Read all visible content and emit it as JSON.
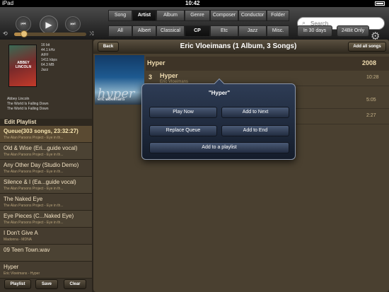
{
  "status": {
    "carrier": "iPad",
    "time": "10:42"
  },
  "transport": {
    "prev": "⏮",
    "play": "▶",
    "next": "⏭",
    "loop": "⟲",
    "shuffle": "⤨",
    "progress": 0.14
  },
  "filters_top": [
    "Song",
    "Artist",
    "Album",
    "Genre",
    "Composer",
    "Conductor",
    "Folder"
  ],
  "filters_top_selected": "Artist",
  "filters_bottom": [
    "All",
    "Albert",
    "Classical",
    "CP",
    "Etc",
    "Jazz",
    "Misc."
  ],
  "filters_bottom_selected": "CP",
  "search": {
    "placeholder": "Search"
  },
  "quick": {
    "recent": "In 30 days",
    "bitdepth": "24Bit Only"
  },
  "now_playing": {
    "file_info": [
      "16 bit",
      "44.1 kHz",
      "AIFF",
      "1411 kbps",
      "64.3 MB",
      "Jazz"
    ],
    "cover_text": "ABBEY LINCOLN",
    "artist": "Abbey Lincoln",
    "track": "The World Is Falling Down",
    "album": "The World Is Falling Down"
  },
  "playlist": {
    "header": "Edit Playlist",
    "items": [
      {
        "title": "Queue(303 songs, 23:32:27)",
        "subtitle": "The Alan Parsons Project - Eye in th..."
      },
      {
        "title": "Old & Wise (Eri...guide vocal)",
        "subtitle": "The Alan Parsons Project - Eye in th..."
      },
      {
        "title": "Any Other Day (Studio Demo)",
        "subtitle": "The Alan Parsons Project - Eye in th..."
      },
      {
        "title": "Silence & I (Ea...guide vocal)",
        "subtitle": "The Alan Parsons Project - Eye in th..."
      },
      {
        "title": "The Naked Eye",
        "subtitle": "The Alan Parsons Project - Eye in th..."
      },
      {
        "title": "Eye Pieces (C...Naked Eye)",
        "subtitle": "The Alan Parsons Project - Eye in th..."
      },
      {
        "title": "I Don't Give A",
        "subtitle": "Madonna - MDNA"
      },
      {
        "title": "09 Teen Town.wav",
        "subtitle": ""
      },
      {
        "title": "Hyper",
        "subtitle": "Eric Vloeimans - Hyper"
      }
    ],
    "buttons": {
      "playlist": "Playlist",
      "save": "Save",
      "clear": "Clear"
    }
  },
  "main": {
    "back": "Back",
    "title": "Eric Vloeimans (1 Album, 3 Songs)",
    "add_all": "Add all songs",
    "album": {
      "name": "Hyper",
      "year": "2008",
      "art_word": "hyper",
      "art_title": "eric vloeimans"
    },
    "tracks": [
      {
        "num": "3",
        "name": "Hyper",
        "artist": "Eric Vloeimans",
        "duration": "10:28"
      },
      {
        "num": "",
        "name": "",
        "artist": "",
        "duration": "5:05"
      },
      {
        "num": "",
        "name": "",
        "artist": "",
        "duration": "2:27"
      }
    ]
  },
  "popup": {
    "title": "\"Hyper\"",
    "play_now": "Play Now",
    "add_next": "Add to Next",
    "replace_queue": "Replace Queue",
    "add_end": "Add to End",
    "add_playlist": "Add to a playlist"
  }
}
